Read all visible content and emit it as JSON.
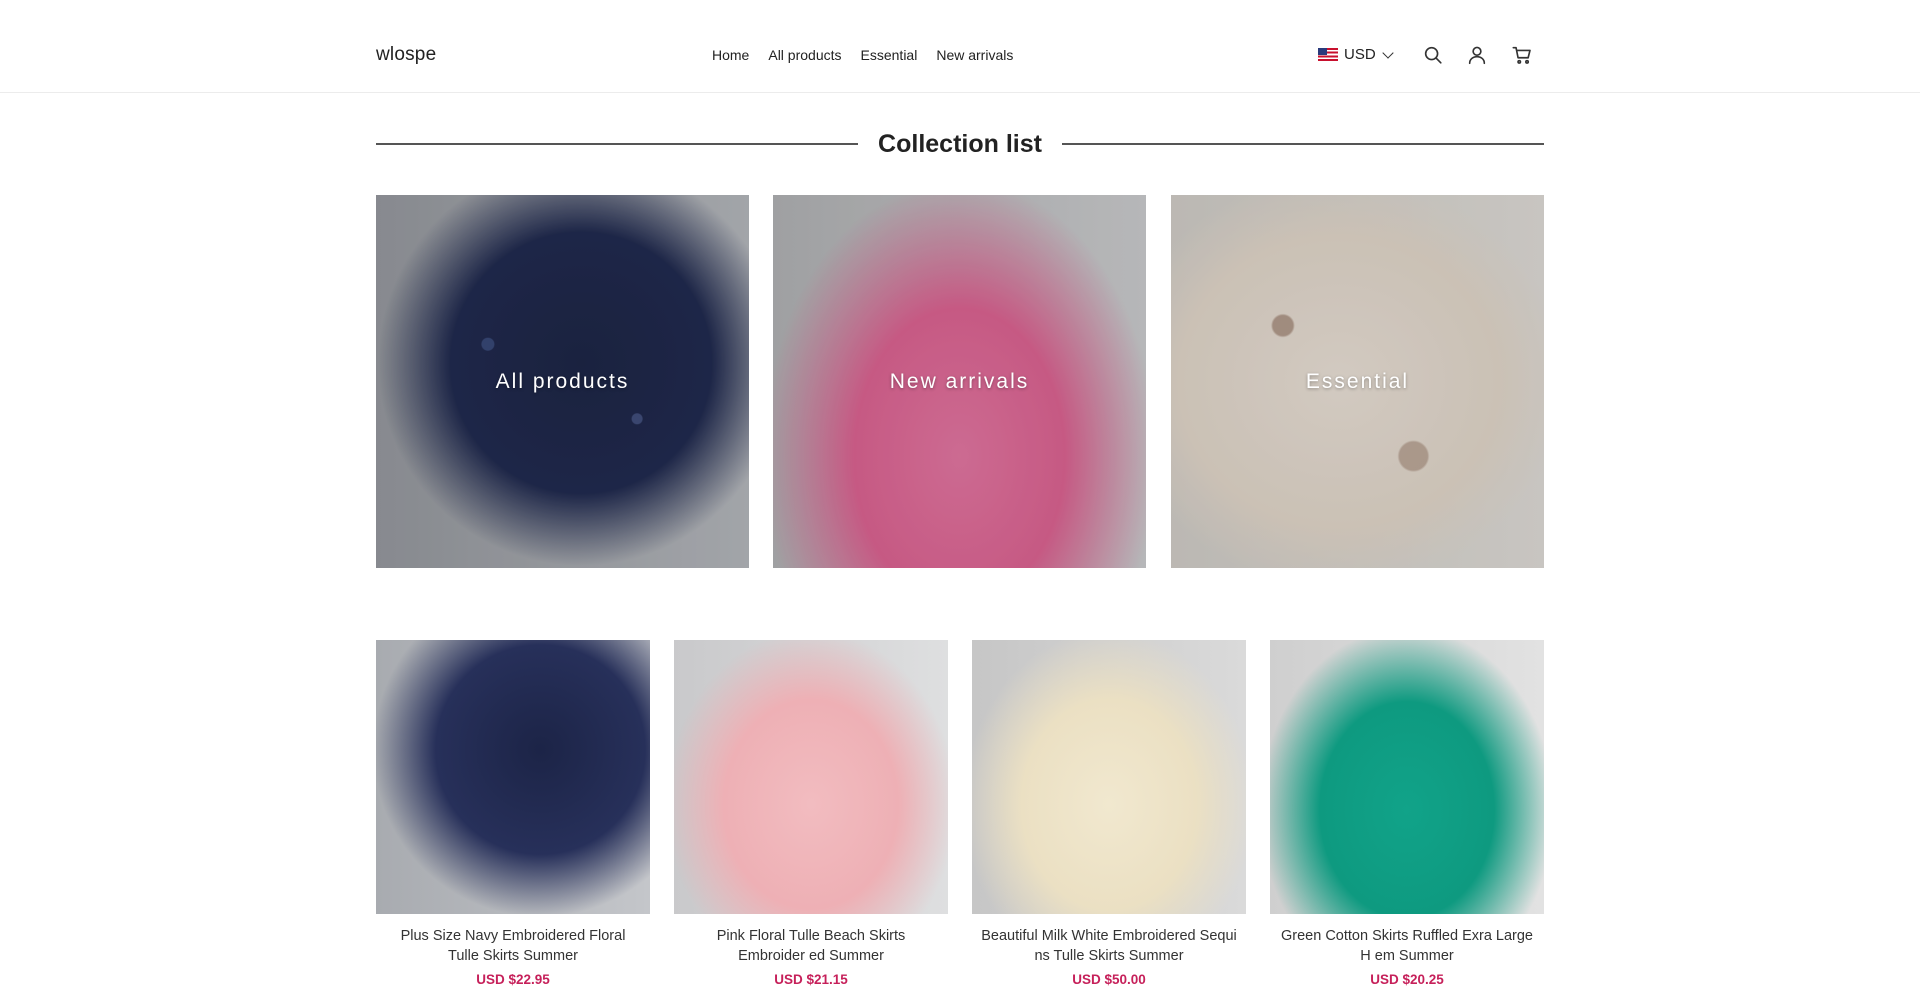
{
  "header": {
    "logo": "wlospe",
    "nav": [
      "Home",
      "All products",
      "Essential",
      "New arrivals"
    ],
    "currency": "USD",
    "icons": [
      "us-flag-icon",
      "chevron-down-icon",
      "search-icon",
      "account-icon",
      "cart-icon"
    ]
  },
  "section": {
    "title": "Collection list"
  },
  "collections": [
    {
      "label": "All products",
      "image": "navy embroidered tulle skirt"
    },
    {
      "label": "New arrivals",
      "image": "pink eyelet skirt"
    },
    {
      "label": "Essential",
      "image": "beige printed skirt"
    }
  ],
  "products": [
    {
      "name": "Plus Size Navy Embroidered Floral Tulle Skirts Summer",
      "price": "USD $22.95"
    },
    {
      "name": "Pink Floral Tulle Beach Skirts Embroider ed Summer",
      "price": "USD $21.15"
    },
    {
      "name": "Beautiful Milk White Embroidered Sequi ns Tulle Skirts Summer",
      "price": "USD $50.00"
    },
    {
      "name": "Green Cotton Skirts Ruffled Exra Large H em Summer",
      "price": "USD $20.25"
    }
  ],
  "colors": {
    "price": "#c6205a",
    "text": "#222222",
    "divider": "#555555"
  }
}
